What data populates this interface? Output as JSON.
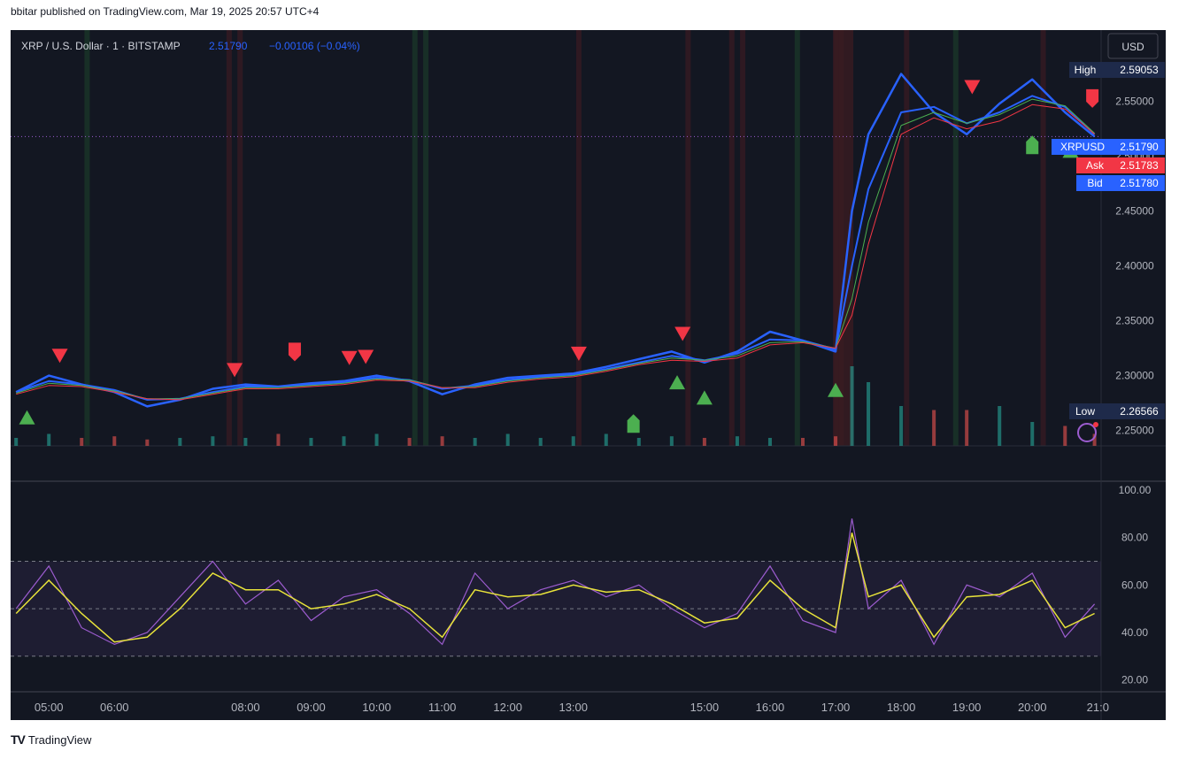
{
  "header": {
    "published": "bbitar published on TradingView.com, Mar 19, 2025 20:57 UTC+4"
  },
  "footer": {
    "brand": "TradingView"
  },
  "symbol": {
    "name": "XRP / U.S. Dollar · 1 · BITSTAMP",
    "price": "2.51790",
    "change": "−0.00106 (−0.04%)"
  },
  "currency": "USD",
  "price_labels": {
    "high_label": "High",
    "high_value": "2.59053",
    "last_label": "XRPUSD",
    "last_value": "2.51790",
    "ask_label": "Ask",
    "ask_value": "2.51783",
    "bid_label": "Bid",
    "bid_value": "2.51780",
    "low_label": "Low",
    "low_value": "2.26566"
  },
  "colors": {
    "background": "#131722",
    "price_line": "#2962ff",
    "ma_green": "#4caf50",
    "ma_red": "#f23645",
    "rsi": "#9c5ccf",
    "rsi_ma": "#e8e33a",
    "up_marker": "#4caf50",
    "down_marker": "#f23645"
  },
  "chart_data": [
    {
      "type": "line",
      "title": "XRP / U.S. Dollar · 1 · BITSTAMP",
      "x": [
        "04:30",
        "05:00",
        "05:30",
        "06:00",
        "06:30",
        "07:00",
        "07:30",
        "08:00",
        "08:30",
        "09:00",
        "09:30",
        "10:00",
        "10:30",
        "11:00",
        "11:30",
        "12:00",
        "12:30",
        "13:00",
        "13:30",
        "14:00",
        "14:30",
        "15:00",
        "15:30",
        "16:00",
        "16:30",
        "17:00",
        "17:15",
        "17:30",
        "18:00",
        "18:30",
        "19:00",
        "19:30",
        "20:00",
        "20:30",
        "20:57"
      ],
      "series": [
        {
          "values": [
            2.285,
            2.3,
            2.292,
            2.285,
            2.272,
            2.278,
            2.288,
            2.292,
            2.29,
            2.293,
            2.295,
            2.3,
            2.295,
            2.283,
            2.292,
            2.298,
            2.3,
            2.302,
            2.308,
            2.315,
            2.322,
            2.312,
            2.322,
            2.34,
            2.332,
            2.322,
            2.45,
            2.52,
            2.575,
            2.54,
            2.52,
            2.548,
            2.57,
            2.54,
            2.518
          ]
        },
        {
          "values": [
            2.285,
            2.295,
            2.292,
            2.287,
            2.278,
            2.279,
            2.285,
            2.29,
            2.29,
            2.292,
            2.294,
            2.298,
            2.296,
            2.288,
            2.291,
            2.296,
            2.299,
            2.301,
            2.306,
            2.312,
            2.318,
            2.314,
            2.32,
            2.333,
            2.332,
            2.324,
            2.4,
            2.47,
            2.54,
            2.545,
            2.53,
            2.54,
            2.555,
            2.545,
            2.52
          ]
        },
        {
          "values": [
            2.284,
            2.293,
            2.291,
            2.286,
            2.279,
            2.279,
            2.284,
            2.289,
            2.289,
            2.291,
            2.293,
            2.297,
            2.296,
            2.289,
            2.29,
            2.295,
            2.298,
            2.3,
            2.305,
            2.311,
            2.316,
            2.314,
            2.318,
            2.33,
            2.331,
            2.325,
            2.37,
            2.44,
            2.528,
            2.54,
            2.53,
            2.538,
            2.552,
            2.546,
            2.521
          ]
        },
        {
          "values": [
            2.283,
            2.291,
            2.29,
            2.285,
            2.279,
            2.278,
            2.283,
            2.288,
            2.288,
            2.29,
            2.292,
            2.296,
            2.295,
            2.289,
            2.289,
            2.294,
            2.297,
            2.299,
            2.304,
            2.31,
            2.314,
            2.313,
            2.316,
            2.328,
            2.33,
            2.325,
            2.355,
            2.42,
            2.52,
            2.535,
            2.525,
            2.532,
            2.547,
            2.543,
            2.52
          ]
        }
      ],
      "ylim": [
        2.236,
        2.615
      ],
      "yticks": [
        "2.25000",
        "2.30000",
        "2.35000",
        "2.40000",
        "2.45000",
        "2.50000",
        "2.55000"
      ],
      "xticks": [
        "05:00",
        "06:00",
        "08:00",
        "09:00",
        "10:00",
        "11:00",
        "12:00",
        "13:00",
        "15:00",
        "16:00",
        "17:00",
        "18:00",
        "19:00",
        "20:00",
        "21:0"
      ],
      "buy_markers": [
        {
          "x": "04:40",
          "y": 2.262,
          "shape": "triangle"
        },
        {
          "x": "13:55",
          "y": 2.256,
          "shape": "arrow"
        },
        {
          "x": "14:35",
          "y": 2.294,
          "shape": "triangle"
        },
        {
          "x": "15:00",
          "y": 2.28,
          "shape": "triangle"
        },
        {
          "x": "17:00",
          "y": 2.287,
          "shape": "triangle"
        },
        {
          "x": "20:00",
          "y": 2.51,
          "shape": "arrow"
        },
        {
          "x": "20:35",
          "y": 2.505,
          "shape": "triangle"
        }
      ],
      "sell_markers": [
        {
          "x": "05:10",
          "y": 2.318,
          "shape": "triangle"
        },
        {
          "x": "07:50",
          "y": 2.305,
          "shape": "triangle"
        },
        {
          "x": "08:45",
          "y": 2.322,
          "shape": "arrow"
        },
        {
          "x": "09:35",
          "y": 2.316,
          "shape": "triangle"
        },
        {
          "x": "09:50",
          "y": 2.317,
          "shape": "triangle"
        },
        {
          "x": "13:05",
          "y": 2.32,
          "shape": "triangle"
        },
        {
          "x": "14:40",
          "y": 2.338,
          "shape": "triangle"
        },
        {
          "x": "19:05",
          "y": 2.563,
          "shape": "triangle"
        },
        {
          "x": "20:55",
          "y": 2.553,
          "shape": "arrow"
        }
      ],
      "volume_relative": [
        0.1,
        0.15,
        0.1,
        0.12,
        0.08,
        0.1,
        0.12,
        0.1,
        0.15,
        0.1,
        0.12,
        0.15,
        0.1,
        0.12,
        0.1,
        0.15,
        0.1,
        0.12,
        0.15,
        0.1,
        0.12,
        0.1,
        0.12,
        0.1,
        0.1,
        0.12,
        1.0,
        0.8,
        0.5,
        0.45,
        0.45,
        0.5,
        0.3,
        0.25,
        0.15
      ]
    },
    {
      "type": "line",
      "x": [
        "04:30",
        "05:00",
        "05:30",
        "06:00",
        "06:30",
        "07:00",
        "07:30",
        "08:00",
        "08:30",
        "09:00",
        "09:30",
        "10:00",
        "10:30",
        "11:00",
        "11:30",
        "12:00",
        "12:30",
        "13:00",
        "13:30",
        "14:00",
        "14:30",
        "15:00",
        "15:30",
        "16:00",
        "16:30",
        "17:00",
        "17:15",
        "17:30",
        "18:00",
        "18:30",
        "19:00",
        "19:30",
        "20:00",
        "20:30",
        "20:57"
      ],
      "series": [
        {
          "values": [
            50,
            68,
            42,
            35,
            40,
            55,
            70,
            52,
            62,
            45,
            55,
            58,
            48,
            35,
            65,
            50,
            58,
            62,
            55,
            60,
            50,
            42,
            48,
            68,
            45,
            40,
            88,
            50,
            62,
            35,
            60,
            55,
            65,
            38,
            52
          ]
        },
        {
          "values": [
            48,
            62,
            48,
            36,
            38,
            50,
            65,
            58,
            58,
            50,
            52,
            56,
            50,
            38,
            58,
            55,
            56,
            60,
            57,
            58,
            52,
            44,
            46,
            62,
            50,
            42,
            82,
            55,
            60,
            38,
            55,
            56,
            62,
            42,
            48
          ]
        }
      ],
      "ylim": [
        15,
        103
      ],
      "yticks": [
        "20.00",
        "40.00",
        "60.00",
        "80.00",
        "100.00"
      ],
      "bands": [
        30,
        50,
        70
      ]
    }
  ]
}
